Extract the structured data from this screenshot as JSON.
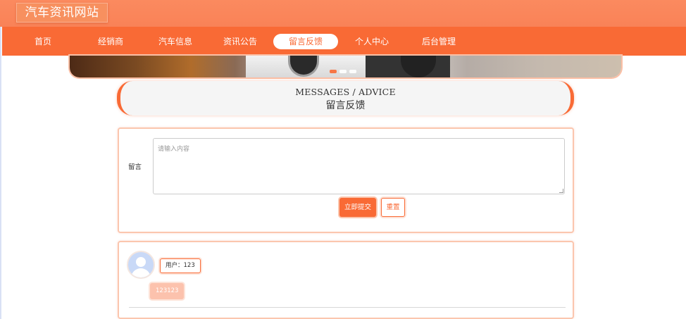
{
  "header": {
    "site_title": "汽车资讯网站"
  },
  "nav": {
    "items": [
      {
        "label": "首页"
      },
      {
        "label": "经销商"
      },
      {
        "label": "汽车信息"
      },
      {
        "label": "资讯公告"
      },
      {
        "label": "留言反馈",
        "active": true
      },
      {
        "label": "个人中心"
      },
      {
        "label": "后台管理"
      }
    ]
  },
  "carousel": {
    "slide_count": 3,
    "active_slide": 1
  },
  "section": {
    "title_en": "MESSAGES / ADVICE",
    "title_zh": "留言反馈"
  },
  "form": {
    "label": "留言",
    "textarea_placeholder": "请输入内容",
    "textarea_value": "",
    "submit_label": "立即提交",
    "reset_label": "重置"
  },
  "comments": [
    {
      "user_label": "用户：123",
      "content": "123123"
    }
  ],
  "colors": {
    "accent": "#f96a35",
    "header_bg": "#fb8a5f",
    "border_light": "#fbc6ae"
  }
}
